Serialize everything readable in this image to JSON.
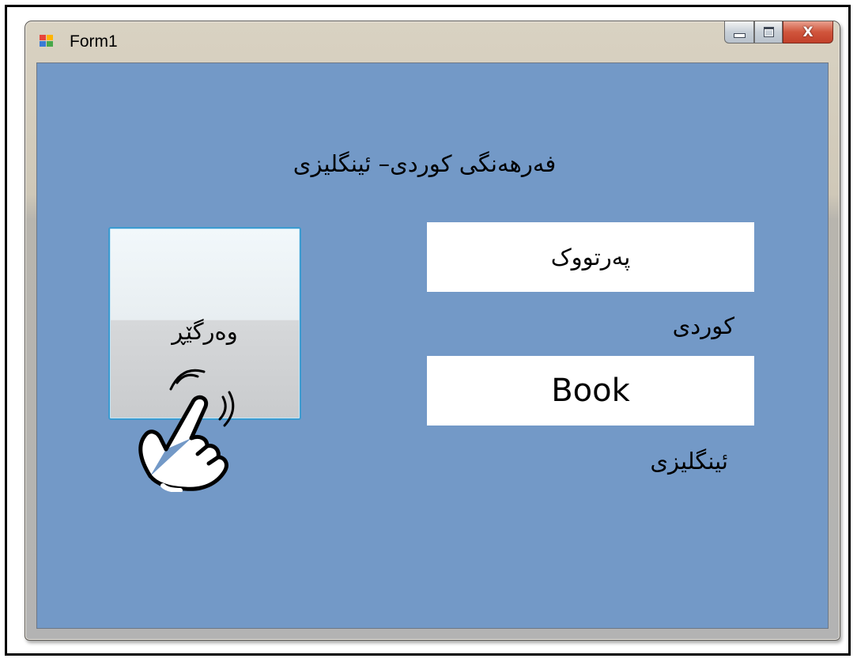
{
  "window": {
    "title": "Form1",
    "icons": {
      "app": "form-app-icon",
      "minimize": "minimize-icon",
      "maximize": "maximize-icon",
      "close": "close-icon"
    },
    "close_glyph": "X"
  },
  "form": {
    "heading": "فەرهەنگی کوردی– ئینگلیزی",
    "translate_button": "وەرگێڕ",
    "kurdish_input_value": "پەرتووک",
    "kurdish_label": "کوردی",
    "english_input_value": "Book",
    "english_label": "ئینگلیزی",
    "cursor_icon": "hand-pointer-icon"
  },
  "colors": {
    "form_background": "#7399c7",
    "button_border": "#3c9bd0",
    "close_button": "#c2402a"
  }
}
